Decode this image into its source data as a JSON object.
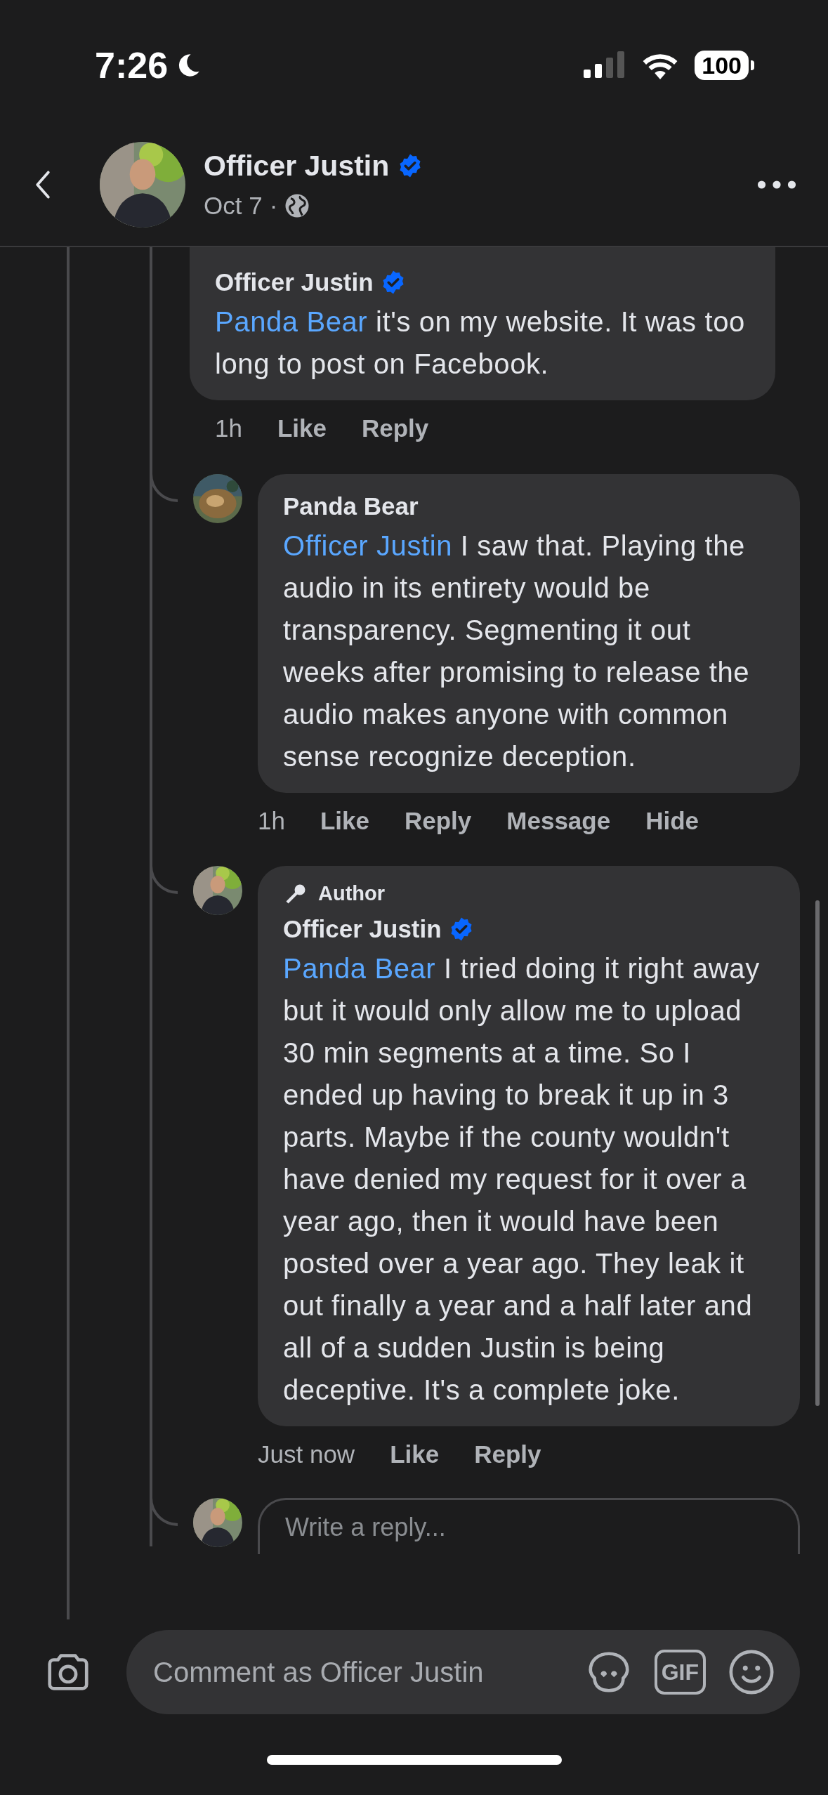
{
  "status_bar": {
    "time": "7:26",
    "battery": "100"
  },
  "header": {
    "name": "Officer Justin",
    "verified": true,
    "date": "Oct 7",
    "separator": "·"
  },
  "comments": [
    {
      "author": "Officer Justin",
      "verified": true,
      "mention": "Panda Bear",
      "text": " it's on my website. It was too long to post on Facebook.",
      "time": "1h",
      "actions": [
        "Like",
        "Reply"
      ]
    },
    {
      "author": "Panda Bear",
      "verified": false,
      "avatar": {
        "kind": "picture"
      },
      "mention": "Officer Justin",
      "text": " I saw that. Playing the audio in its entirety would be transparency.  Segmenting it out weeks after promising to release the audio makes anyone with common sense recognize deception.",
      "time": "1h",
      "actions": [
        "Like",
        "Reply",
        "Message",
        "Hide"
      ]
    },
    {
      "author": "Officer Justin",
      "verified": true,
      "author_badge": "Author",
      "avatar": {
        "kind": "picture"
      },
      "mention": "Panda Bear",
      "text": " I tried doing it right away but it would only allow me to upload 30 min segments at a time. So I ended up having to break it up in 3 parts. Maybe if the county wouldn't have denied my request for it over a year ago, then it would have been posted over a year ago. They leak it out finally a year and a half later and all of a sudden Justin is being deceptive. It's a complete joke.",
      "time": "Just now",
      "actions": [
        "Like",
        "Reply"
      ]
    }
  ],
  "reply_field": {
    "placeholder": "Write a reply..."
  },
  "comment_bar": {
    "placeholder": "Comment as Officer Justin",
    "gif": "GIF"
  }
}
